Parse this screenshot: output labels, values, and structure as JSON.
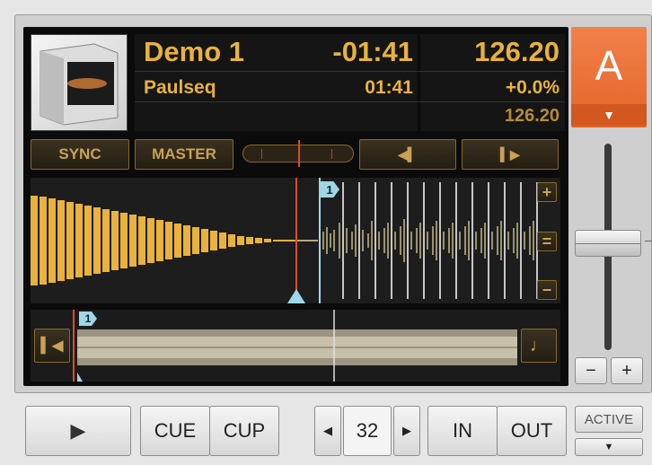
{
  "deck": {
    "letter": "A",
    "title": "Demo 1",
    "artist": "Paulseq",
    "time_remaining": "-01:41",
    "time_elapsed": "01:41",
    "bpm": "126.20",
    "tempo_offset": "+0.0%",
    "original_bpm": "126.20"
  },
  "buttons": {
    "sync": "SYNC",
    "master": "MASTER",
    "cue": "CUE",
    "cup": "CUP",
    "loop_size": "32",
    "loop_in": "IN",
    "loop_out": "OUT",
    "active": "ACTIVE",
    "tempo_minus": "−",
    "tempo_plus": "+",
    "zoom_in": "+",
    "zoom_reset": "=",
    "zoom_out": "−"
  },
  "markers": {
    "cue_label": "1",
    "stripe_cue_label": "1"
  },
  "icons": {
    "play": "play-icon",
    "beatjump_back": "beatjump-back-icon",
    "beatjump_forward": "beatjump-forward-icon",
    "restart": "skip-to-start-icon",
    "note": "note-icon",
    "loop_decrease": "chevron-left-icon",
    "loop_increase": "chevron-right-icon",
    "active_menu": "chevron-down-icon",
    "deck_menu": "chevron-down-icon"
  },
  "state": {
    "playback_position": 0.09,
    "tempo_fader": 0.5,
    "phase_offset": 0.0
  },
  "colors": {
    "accent": "#e8b23c",
    "deck_color": "#e56426",
    "playhead": "#e04a2a",
    "cue": "#9fd7e6"
  }
}
